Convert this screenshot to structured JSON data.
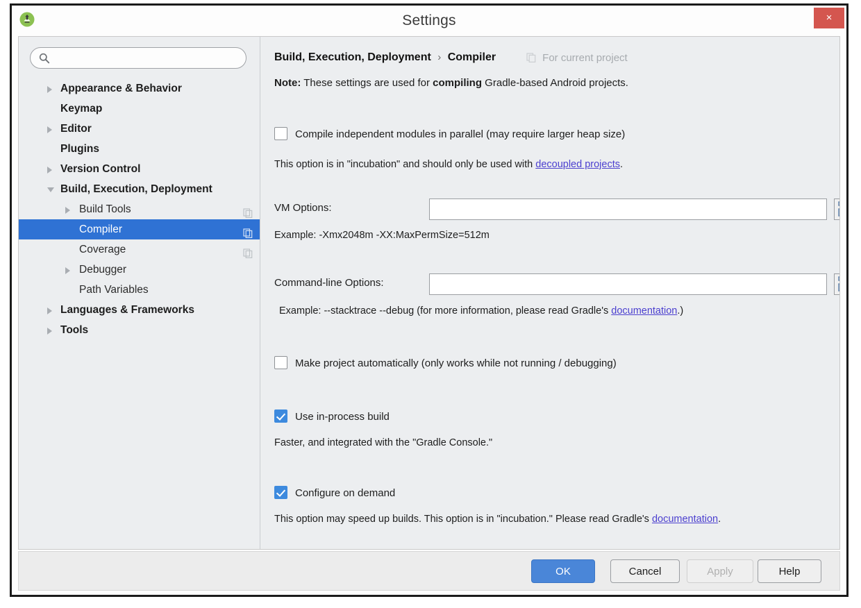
{
  "window": {
    "title": "Settings",
    "app_icon": "android-studio-icon",
    "close_label": "×"
  },
  "sidebar": {
    "search": {
      "value": "",
      "placeholder": ""
    },
    "items": [
      {
        "label": "Appearance & Behavior",
        "level": 0,
        "arrow": "collapsed",
        "selected": false,
        "copy": false
      },
      {
        "label": "Keymap",
        "level": 0,
        "arrow": "none",
        "selected": false,
        "copy": false
      },
      {
        "label": "Editor",
        "level": 0,
        "arrow": "collapsed",
        "selected": false,
        "copy": false
      },
      {
        "label": "Plugins",
        "level": 0,
        "arrow": "none",
        "selected": false,
        "copy": false
      },
      {
        "label": "Version Control",
        "level": 0,
        "arrow": "collapsed",
        "selected": false,
        "copy": false
      },
      {
        "label": "Build, Execution, Deployment",
        "level": 0,
        "arrow": "expanded",
        "selected": false,
        "copy": false
      },
      {
        "label": "Build Tools",
        "level": 1,
        "arrow": "collapsed",
        "selected": false,
        "copy": true
      },
      {
        "label": "Compiler",
        "level": 1,
        "arrow": "none",
        "selected": true,
        "copy": true
      },
      {
        "label": "Coverage",
        "level": 1,
        "arrow": "none",
        "selected": false,
        "copy": true
      },
      {
        "label": "Debugger",
        "level": 1,
        "arrow": "collapsed",
        "selected": false,
        "copy": false
      },
      {
        "label": "Path Variables",
        "level": 1,
        "arrow": "none",
        "selected": false,
        "copy": false
      },
      {
        "label": "Languages & Frameworks",
        "level": 0,
        "arrow": "collapsed",
        "selected": false,
        "copy": false
      },
      {
        "label": "Tools",
        "level": 0,
        "arrow": "collapsed",
        "selected": false,
        "copy": false
      }
    ]
  },
  "content": {
    "breadcrumb_root": "Build, Execution, Deployment",
    "breadcrumb_sep": "›",
    "breadcrumb_leaf": "Compiler",
    "scope_hint": "For current project",
    "note_prefix": "Note:",
    "note_body_1": " These settings are used for ",
    "note_bold": "compiling",
    "note_body_2": " Gradle-based Android projects.",
    "parallel_checkbox": {
      "label": "Compile independent modules in parallel (may require larger heap size)",
      "checked": false
    },
    "parallel_help_1": "This option is in \"incubation\" and should only be used with ",
    "parallel_help_link": "decoupled projects",
    "parallel_help_2": ".",
    "vm_options": {
      "label": "VM Options:",
      "value": "",
      "placeholder": ""
    },
    "vm_example": "Example: -Xmx2048m -XX:MaxPermSize=512m",
    "cmdline_options": {
      "label": "Command-line Options:",
      "value": "",
      "placeholder": ""
    },
    "cmdline_example_1": "Example: --stacktrace --debug (for more information, please read Gradle's ",
    "cmdline_example_link": "documentation",
    "cmdline_example_2": ".)",
    "make_auto_checkbox": {
      "label": "Make project automatically (only works while not running / debugging)",
      "checked": false
    },
    "in_process_checkbox": {
      "label": "Use in-process build",
      "checked": true
    },
    "in_process_help": "Faster, and integrated with the \"Gradle Console.\"",
    "configure_on_demand_checkbox": {
      "label": "Configure on demand",
      "checked": true
    },
    "configure_help_1": "This option may speed up builds. This option is in \"incubation.\" Please read Gradle's ",
    "configure_help_link": "documentation",
    "configure_help_2": "."
  },
  "footer": {
    "ok": "OK",
    "cancel": "Cancel",
    "apply": "Apply",
    "help": "Help"
  },
  "colors": {
    "selection_blue": "#2f72d4",
    "primary_button": "#4a86d8",
    "checkbox_blue": "#3d8ade",
    "close_red": "#d4564f",
    "link_purple": "#4b3fcf",
    "panel_bg": "#eceef0"
  }
}
